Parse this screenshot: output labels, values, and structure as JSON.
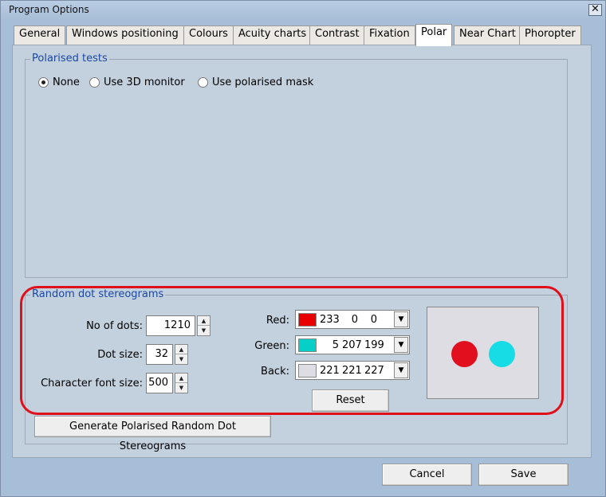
{
  "window": {
    "title": "Program Options",
    "close_glyph": "✕"
  },
  "tabs": [
    {
      "label": "General"
    },
    {
      "label": "Windows positioning"
    },
    {
      "label": "Colours"
    },
    {
      "label": "Acuity charts"
    },
    {
      "label": "Contrast"
    },
    {
      "label": "Fixation"
    },
    {
      "label": "Polar"
    },
    {
      "label": "Near Chart"
    },
    {
      "label": "Phoropter"
    }
  ],
  "active_tab": "Polar",
  "polarised": {
    "title": "Polarised tests",
    "options": [
      {
        "label": "None",
        "selected": true
      },
      {
        "label": "Use 3D monitor",
        "selected": false
      },
      {
        "label": "Use polarised mask",
        "selected": false
      }
    ]
  },
  "rds": {
    "title": "Random dot stereograms",
    "dots_label": "No of dots:",
    "dots_value": "1210",
    "size_label": "Dot size:",
    "size_value": "32",
    "font_label": "Character font size:",
    "font_value": "500",
    "red": {
      "label": "Red:",
      "r": "233",
      "g": "0",
      "b": "0",
      "color": "#e90000"
    },
    "green": {
      "label": "Green:",
      "r": "5",
      "g": "207",
      "b": "199",
      "color": "#05cfc7"
    },
    "back": {
      "label": "Back:",
      "r": "221",
      "g": "221",
      "b": "227",
      "color": "#dddde3"
    },
    "reset_label": "Reset",
    "preview_dot_colors": [
      "#e0101f",
      "#17dce6"
    ]
  },
  "generate_label": "Generate Polarised Random Dot Stereograms",
  "footer": {
    "cancel_label": "Cancel",
    "save_label": "Save"
  },
  "icons": {
    "spin_up": "▲",
    "spin_down": "▼",
    "dropdown": "▼"
  }
}
